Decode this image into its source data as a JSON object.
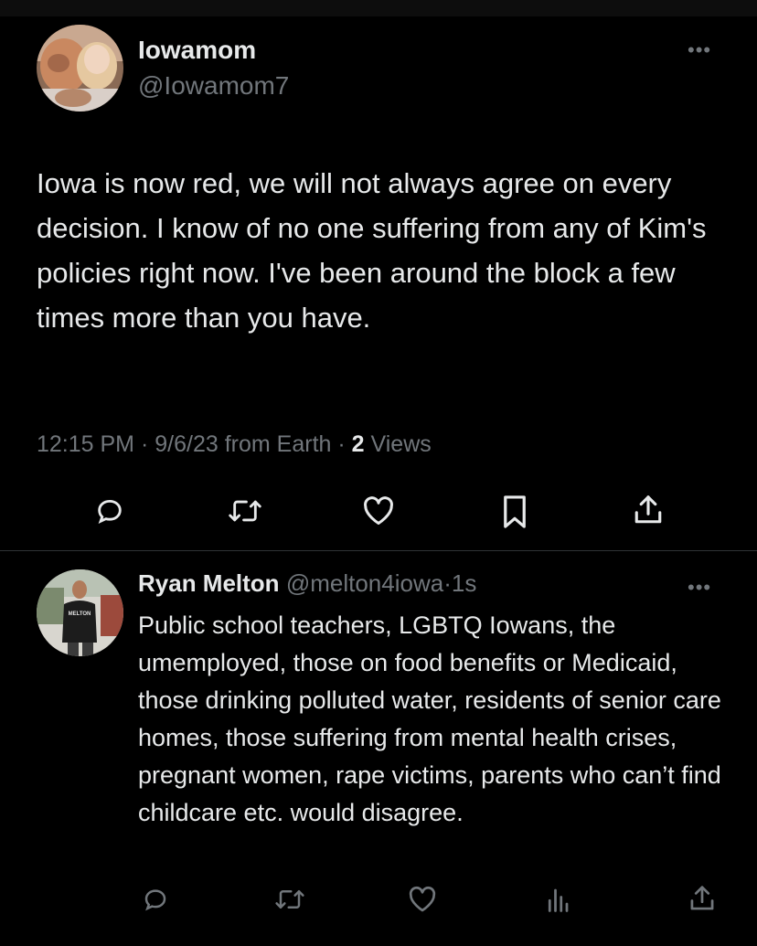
{
  "tweet": {
    "author_name": "Iowamom",
    "author_handle": "@Iowamom7",
    "text": "Iowa is now red, we will not always agree on every decision. I know of no one suffering from any of Kim's policies right now. I've been around the block a few times more than you have.",
    "time": "12:15 PM",
    "date": "9/6/23",
    "source": "from Earth",
    "views_count": "2",
    "views_label": "Views",
    "actions": [
      "reply-icon",
      "retweet-icon",
      "like-icon",
      "bookmark-icon",
      "share-icon"
    ]
  },
  "reply": {
    "author_name": "Ryan Melton",
    "author_handle": "@melton4iowa",
    "age": "1s",
    "text": "Public school teachers, LGBTQ Iowans, the umemployed, those on food benefits or Medicaid, those drinking polluted water, residents of senior care homes, those suffering from mental health crises, pregnant women, rape victims, parents who can’t find childcare etc. would disagree.",
    "avatar_shirt_text": "MELTON",
    "actions": [
      "reply-icon",
      "retweet-icon",
      "like-icon",
      "analytics-icon",
      "share-icon"
    ]
  },
  "separators": {
    "dot": "·",
    "more": "•••"
  },
  "colors": {
    "background": "#000000",
    "text": "#e7e9ea",
    "secondary": "#71767b",
    "divider": "#2f3336"
  }
}
